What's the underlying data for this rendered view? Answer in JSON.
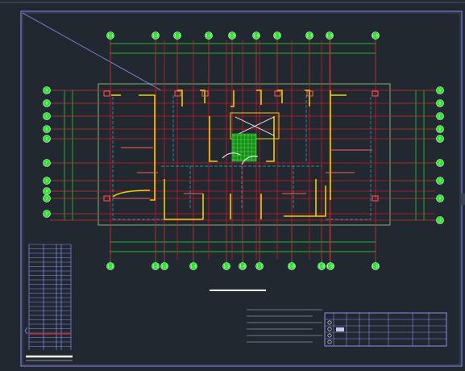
{
  "drawing": {
    "background_color": "#212830",
    "frame_color": "#8a8ff0",
    "grid_color": "#cc1a2a",
    "dimension_color": "#29e629",
    "wall_color": "#f0d000",
    "dash_color": "#3fa9c8",
    "axis_marker_fill": "#29e629"
  },
  "axes": {
    "top": [
      "1-1",
      "1-2",
      "1-3",
      "1-4",
      "1-5",
      "1-6",
      "1-7",
      "1-8",
      "1-9",
      "1-10"
    ],
    "bottom": [
      "1-1",
      "1-2",
      "1-3",
      "1-4",
      "1-5",
      "1-6",
      "1-7",
      "1-8",
      "1-9",
      "1-10",
      "1-11"
    ],
    "left": [
      "A",
      "B",
      "C",
      "D",
      "E",
      "F",
      "G",
      "H",
      "J",
      "K"
    ],
    "right": [
      "A",
      "B",
      "C",
      "D",
      "E",
      "F",
      "G",
      "H",
      "J"
    ]
  },
  "title_block": {
    "row_markers": [
      "1",
      "2",
      "3",
      "4"
    ]
  }
}
